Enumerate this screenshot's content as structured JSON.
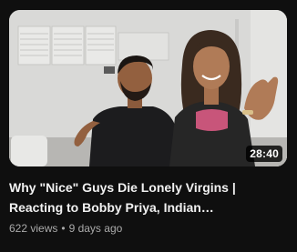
{
  "video": {
    "duration": "28:40",
    "title_line1": "Why \"Nice\" Guys Die Lonely Virgins |",
    "title_line2": "Reacting to Bobby Priya, Indian…",
    "views": "622 views",
    "separator": "•",
    "age": "9 days ago"
  }
}
